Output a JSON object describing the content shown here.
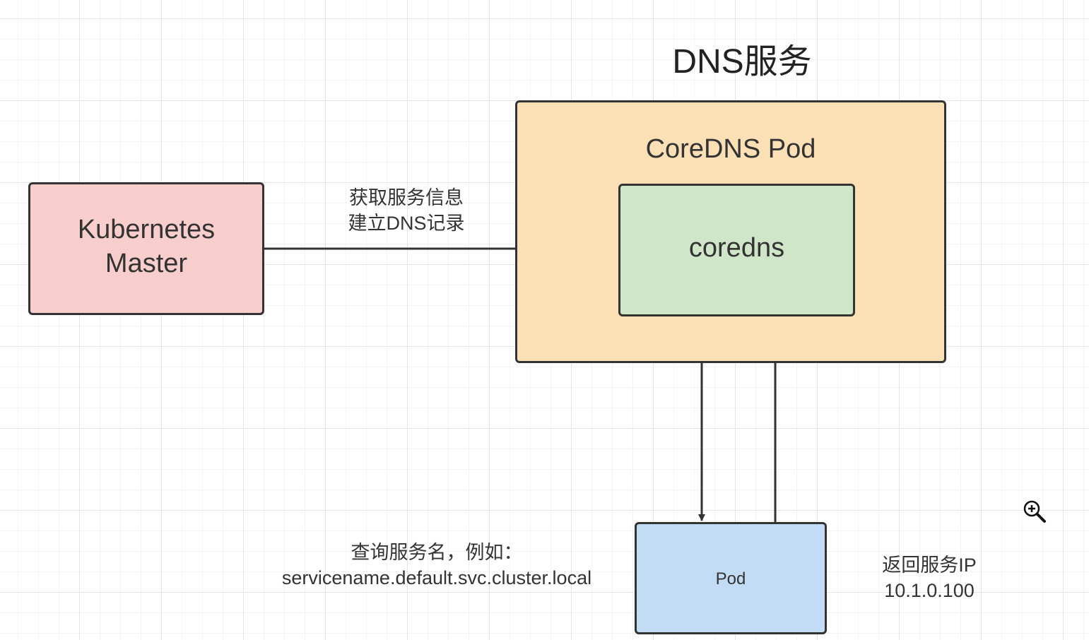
{
  "diagram": {
    "title": "DNS服务",
    "nodes": {
      "master": {
        "label_line1": "Kubernetes",
        "label_line2": "Master",
        "fill": "#f8cecc"
      },
      "coredns_pod": {
        "label": "CoreDNS Pod",
        "fill": "#fbe0b5"
      },
      "coredns": {
        "label": "coredns",
        "fill": "#d0e6c9"
      },
      "pod": {
        "label": "Pod",
        "fill": "#c3dcf5"
      }
    },
    "edges": {
      "fetch": {
        "line1": "获取服务信息",
        "line2": "建立DNS记录"
      },
      "query": {
        "line1": "查询服务名，例如：",
        "line2": "servicename.default.svc.cluster.local"
      },
      "return": {
        "line1": "返回服务IP",
        "line2": "10.1.0.100"
      }
    },
    "stroke_color": "#333333"
  },
  "cursor": {
    "icon": "zoom-in-icon"
  }
}
